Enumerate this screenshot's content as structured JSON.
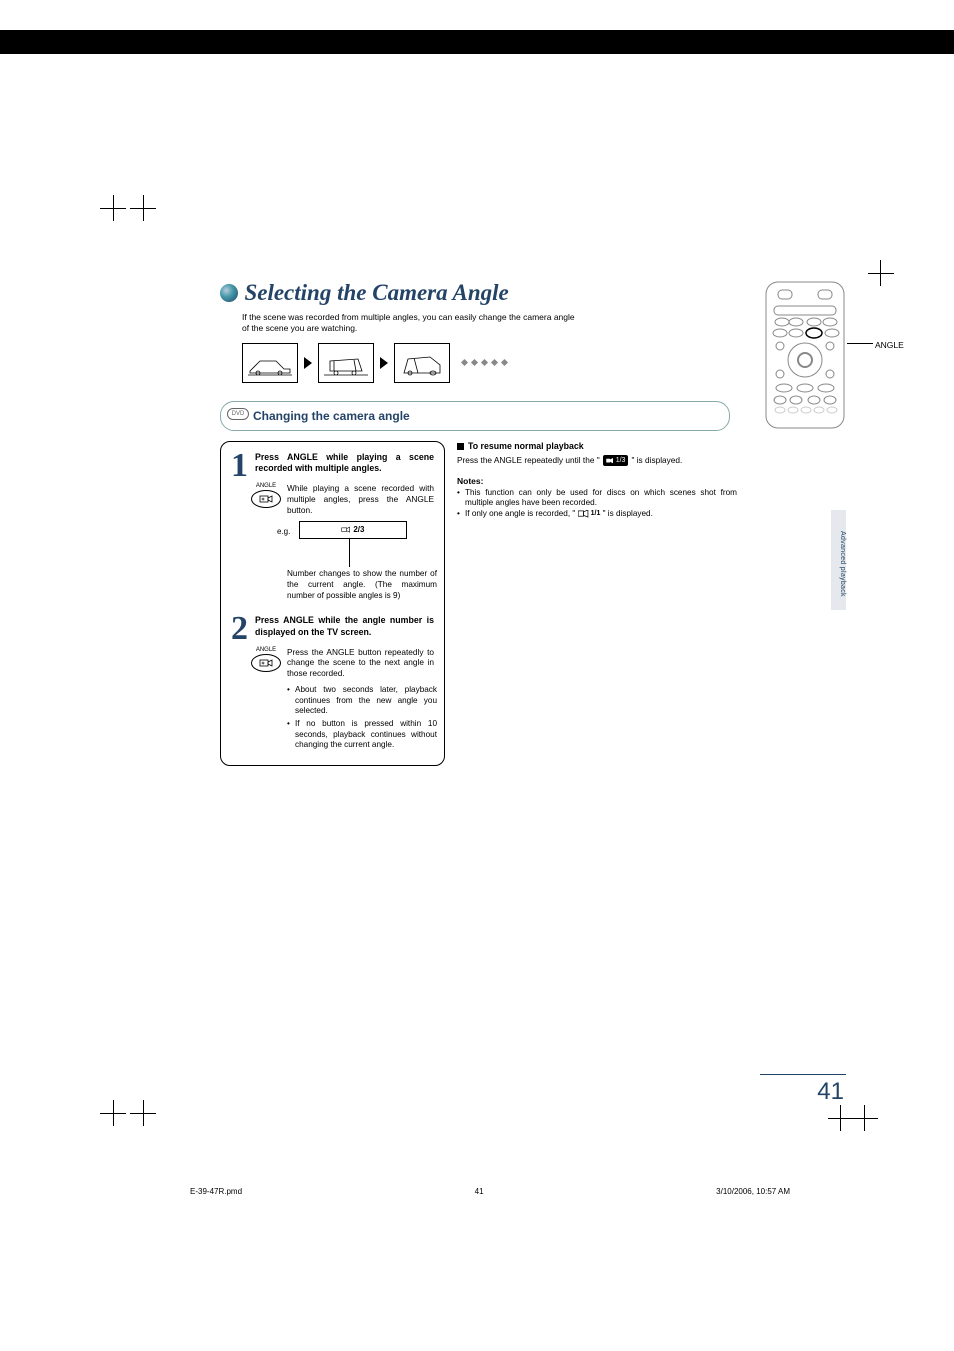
{
  "title": "Selecting the Camera Angle",
  "intro": "If the scene was recorded from multiple angles, you can easily change the camera angle of the scene you are watching.",
  "remote_label": "ANGLE",
  "section": {
    "pill": "DVD",
    "title": "Changing the camera angle"
  },
  "step1": {
    "num": "1",
    "head": "Press ANGLE while playing a scene recorded with multiple angles.",
    "btn_label": "ANGLE",
    "desc": "While playing a scene recorded with multiple angles, press the ANGLE button.",
    "eg": "e.g.",
    "display_value": "2/3",
    "caption": "Number changes to show the number of the current angle. (The maximum number of possible angles is 9)"
  },
  "step2": {
    "num": "2",
    "head": "Press ANGLE while the angle number is displayed on the TV screen.",
    "btn_label": "ANGLE",
    "desc": "Press the ANGLE button repeatedly to change the scene to the next angle in those recorded.",
    "bullets": [
      "About two seconds later, playback continues from the new angle you selected.",
      "If no button is pressed within 10 seconds, playback continues without changing the current angle."
    ]
  },
  "resume": {
    "head": "To resume normal playback",
    "body_a": "Press the ANGLE repeatedly until the \"",
    "pill": "1/3",
    "body_b": "\" is displayed."
  },
  "notes": {
    "head": "Notes:",
    "items_a": "This function can only be used for discs on which scenes shot from multiple angles have been recorded.",
    "items_b_a": "If only one angle is recorded, \"",
    "items_b_icon": "1/1",
    "items_b_b": "\" is displayed."
  },
  "side_tab": "Advanced playback",
  "page_number": "41",
  "footer": {
    "file": "E-39-47R.pmd",
    "page": "41",
    "date": "3/10/2006, 10:57 AM"
  }
}
